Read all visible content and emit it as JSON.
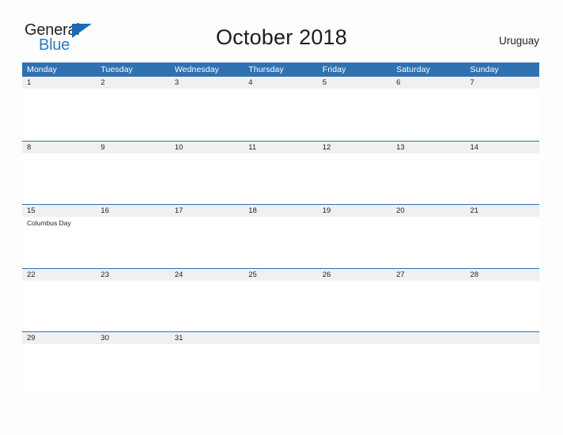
{
  "brand": {
    "name_part_1": "General",
    "name_part_2": "Blue",
    "triangle_icon": "blue-triangle-icon",
    "color_dark": "#231f20",
    "color_blue": "#2b7cc4"
  },
  "header": {
    "title": "October 2018",
    "country": "Uruguay"
  },
  "theme": {
    "header_blue": "#2f72b4",
    "band_gray": "#f0f0f0",
    "text_dark": "#231f20",
    "background": "#fdfdfd"
  },
  "calendar": {
    "month": "October",
    "year": "2018",
    "weekdays": [
      "Monday",
      "Tuesday",
      "Wednesday",
      "Thursday",
      "Friday",
      "Saturday",
      "Sunday"
    ],
    "weeks": [
      {
        "days": [
          {
            "number": "1",
            "events": []
          },
          {
            "number": "2",
            "events": []
          },
          {
            "number": "3",
            "events": []
          },
          {
            "number": "4",
            "events": []
          },
          {
            "number": "5",
            "events": []
          },
          {
            "number": "6",
            "events": []
          },
          {
            "number": "7",
            "events": []
          }
        ]
      },
      {
        "days": [
          {
            "number": "8",
            "events": []
          },
          {
            "number": "9",
            "events": []
          },
          {
            "number": "10",
            "events": []
          },
          {
            "number": "11",
            "events": []
          },
          {
            "number": "12",
            "events": []
          },
          {
            "number": "13",
            "events": []
          },
          {
            "number": "14",
            "events": []
          }
        ]
      },
      {
        "days": [
          {
            "number": "15",
            "events": [
              "Columbus Day"
            ]
          },
          {
            "number": "16",
            "events": []
          },
          {
            "number": "17",
            "events": []
          },
          {
            "number": "18",
            "events": []
          },
          {
            "number": "19",
            "events": []
          },
          {
            "number": "20",
            "events": []
          },
          {
            "number": "21",
            "events": []
          }
        ]
      },
      {
        "days": [
          {
            "number": "22",
            "events": []
          },
          {
            "number": "23",
            "events": []
          },
          {
            "number": "24",
            "events": []
          },
          {
            "number": "25",
            "events": []
          },
          {
            "number": "26",
            "events": []
          },
          {
            "number": "27",
            "events": []
          },
          {
            "number": "28",
            "events": []
          }
        ]
      },
      {
        "days": [
          {
            "number": "29",
            "events": []
          },
          {
            "number": "30",
            "events": []
          },
          {
            "number": "31",
            "events": []
          },
          {
            "number": "",
            "events": []
          },
          {
            "number": "",
            "events": []
          },
          {
            "number": "",
            "events": []
          },
          {
            "number": "",
            "events": []
          }
        ]
      }
    ]
  }
}
